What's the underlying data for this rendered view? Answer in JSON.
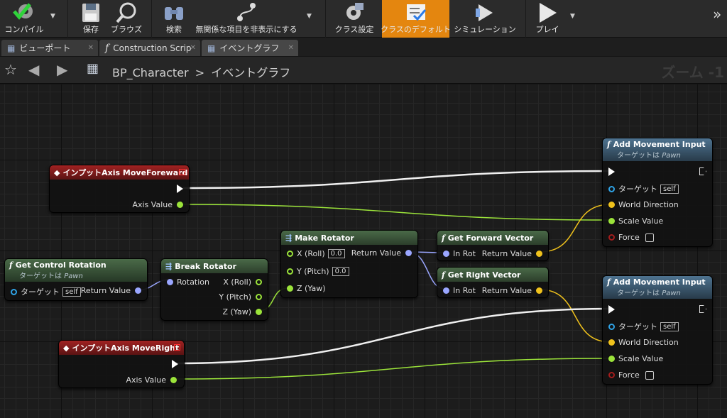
{
  "toolbar": {
    "compile": "コンパイル",
    "save": "保存",
    "browse": "ブラウズ",
    "find": "検索",
    "hide_unrelated": "無関係な項目を非表示にする",
    "class_settings": "クラス設定",
    "class_defaults": "クラスのデフォルト",
    "simulation": "シミュレーション",
    "play": "プレイ",
    "overflow": "»"
  },
  "tabs": [
    {
      "label": "ビューポート"
    },
    {
      "label": "Construction Scrip"
    },
    {
      "label": "イベントグラフ"
    }
  ],
  "breadcrumb": {
    "blueprint": "BP_Character",
    "separator": ">",
    "graph": "イベントグラフ"
  },
  "zoom_label": "ズーム -1",
  "nodes": {
    "move_forward": {
      "title": "インプットAxis MoveForeward",
      "axis_value": "Axis Value"
    },
    "move_right": {
      "title": "インプットAxis MoveRight",
      "axis_value": "Axis Value"
    },
    "get_control_rotation": {
      "title": "Get Control Rotation",
      "subtitle_prefix": "ターゲットは",
      "subtitle_target": "Pawn",
      "target_label": "ターゲット",
      "target_value": "self",
      "return": "Return Value"
    },
    "break_rotator": {
      "title": "Break Rotator",
      "rotation": "Rotation",
      "x": "X (Roll)",
      "y": "Y (Pitch)",
      "z": "Z (Yaw)"
    },
    "make_rotator": {
      "title": "Make Rotator",
      "x": "X (Roll)",
      "x_val": "0.0",
      "y": "Y (Pitch)",
      "y_val": "0.0",
      "z": "Z (Yaw)",
      "return": "Return Value"
    },
    "get_forward_vector": {
      "title": "Get Forward Vector",
      "in_rot": "In Rot",
      "return": "Return Value"
    },
    "get_right_vector": {
      "title": "Get Right Vector",
      "in_rot": "In Rot",
      "return": "Return Value"
    },
    "add_movement_1": {
      "title": "Add Movement Input",
      "subtitle_prefix": "ターゲットは",
      "subtitle_target": "Pawn",
      "target_label": "ターゲット",
      "target_value": "self",
      "world_direction": "World Direction",
      "scale_value": "Scale Value",
      "force": "Force"
    },
    "add_movement_2": {
      "title": "Add Movement Input",
      "subtitle_prefix": "ターゲットは",
      "subtitle_target": "Pawn",
      "target_label": "ターゲット",
      "target_value": "self",
      "world_direction": "World Direction",
      "scale_value": "Scale Value",
      "force": "Force"
    }
  },
  "colors": {
    "accent": "#e4860f",
    "float_pin": "#9be33a",
    "vector_pin": "#f0c21c",
    "rotator_pin": "#9aa6ff",
    "object_pin": "#2fa3e6",
    "bool_pin": "#a31c1c",
    "event_header": "#a12222"
  }
}
